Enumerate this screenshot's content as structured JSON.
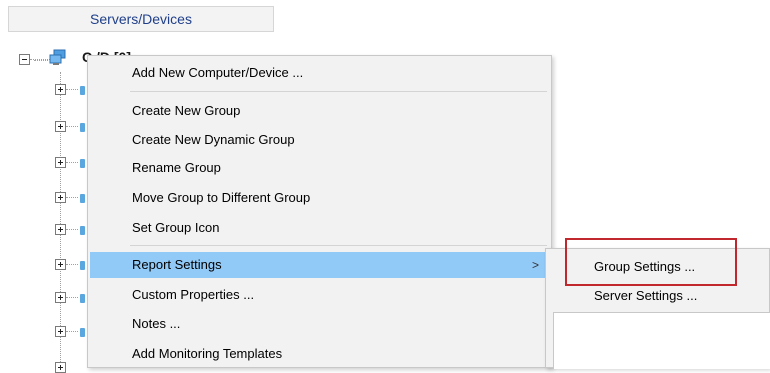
{
  "tree": {
    "header": "Servers/Devices",
    "root_label": "C                 /D          [0]"
  },
  "context_menu": {
    "items": [
      {
        "label": "Add New Computer/Device ..."
      },
      {
        "label": "Create New Group"
      },
      {
        "label": "Create New Dynamic Group"
      },
      {
        "label": "Rename Group"
      },
      {
        "label": "Move Group to Different Group"
      },
      {
        "label": "Set Group Icon"
      },
      {
        "label": "Report Settings",
        "submenu_arrow": ">"
      },
      {
        "label": "Custom Properties ..."
      },
      {
        "label": "Notes ..."
      },
      {
        "label": "Add Monitoring Templates"
      }
    ],
    "highlighted": "Report Settings"
  },
  "submenu": {
    "items": [
      {
        "label": "Group Settings ..."
      },
      {
        "label": "Server Settings ..."
      }
    ]
  },
  "colors": {
    "highlight": "#91c9f7",
    "annotation_box": "#c0282d",
    "header_text": "#1f3f8a"
  },
  "icons": [
    "collapse-icon",
    "expand-icon",
    "computer-group-icon",
    "submenu-arrow-icon"
  ]
}
